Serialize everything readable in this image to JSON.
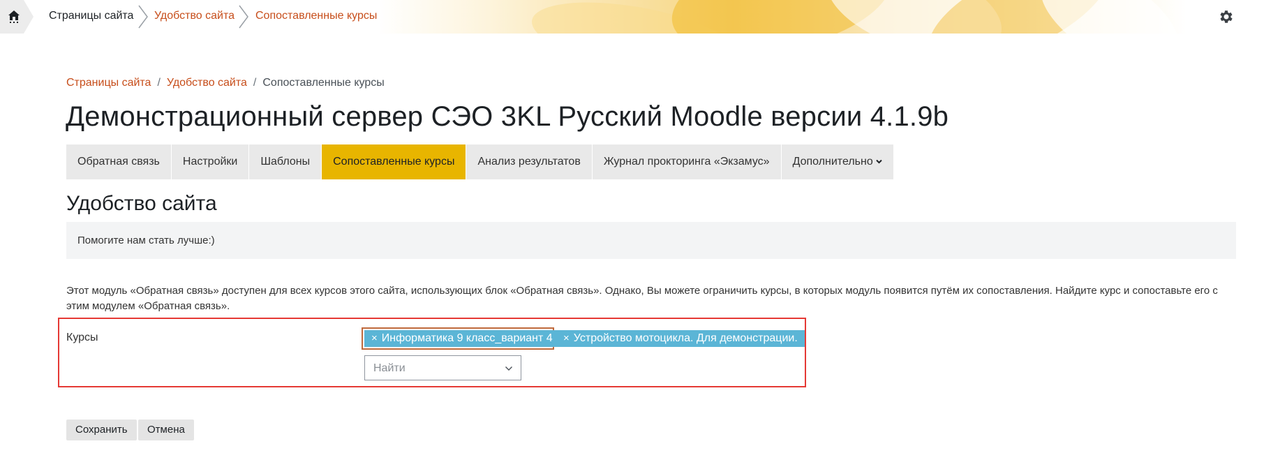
{
  "topnav": {
    "items": [
      {
        "label": "Страницы сайта"
      },
      {
        "label": "Удобство сайта"
      },
      {
        "label": "Сопоставленные курсы"
      }
    ]
  },
  "breadcrumb": {
    "items": [
      {
        "label": "Страницы сайта"
      },
      {
        "label": "Удобство сайта"
      },
      {
        "label": "Сопоставленные курсы"
      }
    ],
    "separator": "/"
  },
  "page": {
    "title": "Демонстрационный сервер СЭО 3KL Русский Moodle версии 4.1.9b",
    "section_title": "Удобство сайта",
    "intro": "Помогите нам стать лучше:)",
    "description": "Этот модуль «Обратная связь» доступен для всех курсов этого сайта, использующих блок «Обратная связь». Однако, Вы можете ограничить курсы, в которых модуль появится путём их сопоставления. Найдите курс и сопоставьте его с этим модулем «Обратная связь»."
  },
  "tabs": [
    {
      "label": "Обратная связь"
    },
    {
      "label": "Настройки"
    },
    {
      "label": "Шаблоны"
    },
    {
      "label": "Сопоставленные курсы",
      "active": true
    },
    {
      "label": "Анализ результатов"
    },
    {
      "label": "Журнал прокторинга «Экзамус»"
    },
    {
      "label": "Дополнительно"
    }
  ],
  "form": {
    "courses_label": "Курсы",
    "selected": [
      {
        "label": "Информатика 9 класс_вариант 4"
      },
      {
        "label": "Устройство мотоцикла. Для демонстрации."
      }
    ],
    "remove_glyph": "×",
    "search_placeholder": "Найти",
    "save_label": "Сохранить",
    "cancel_label": "Отмена"
  },
  "colors": {
    "accent": "#e8b500",
    "link": "#c74e1b",
    "chip": "#5bb5d6",
    "highlight": "#e53935"
  },
  "icons": {
    "home": "home-icon",
    "settings": "gear-icon",
    "dropdown": "chevron-down-icon",
    "remove": "close-icon"
  }
}
